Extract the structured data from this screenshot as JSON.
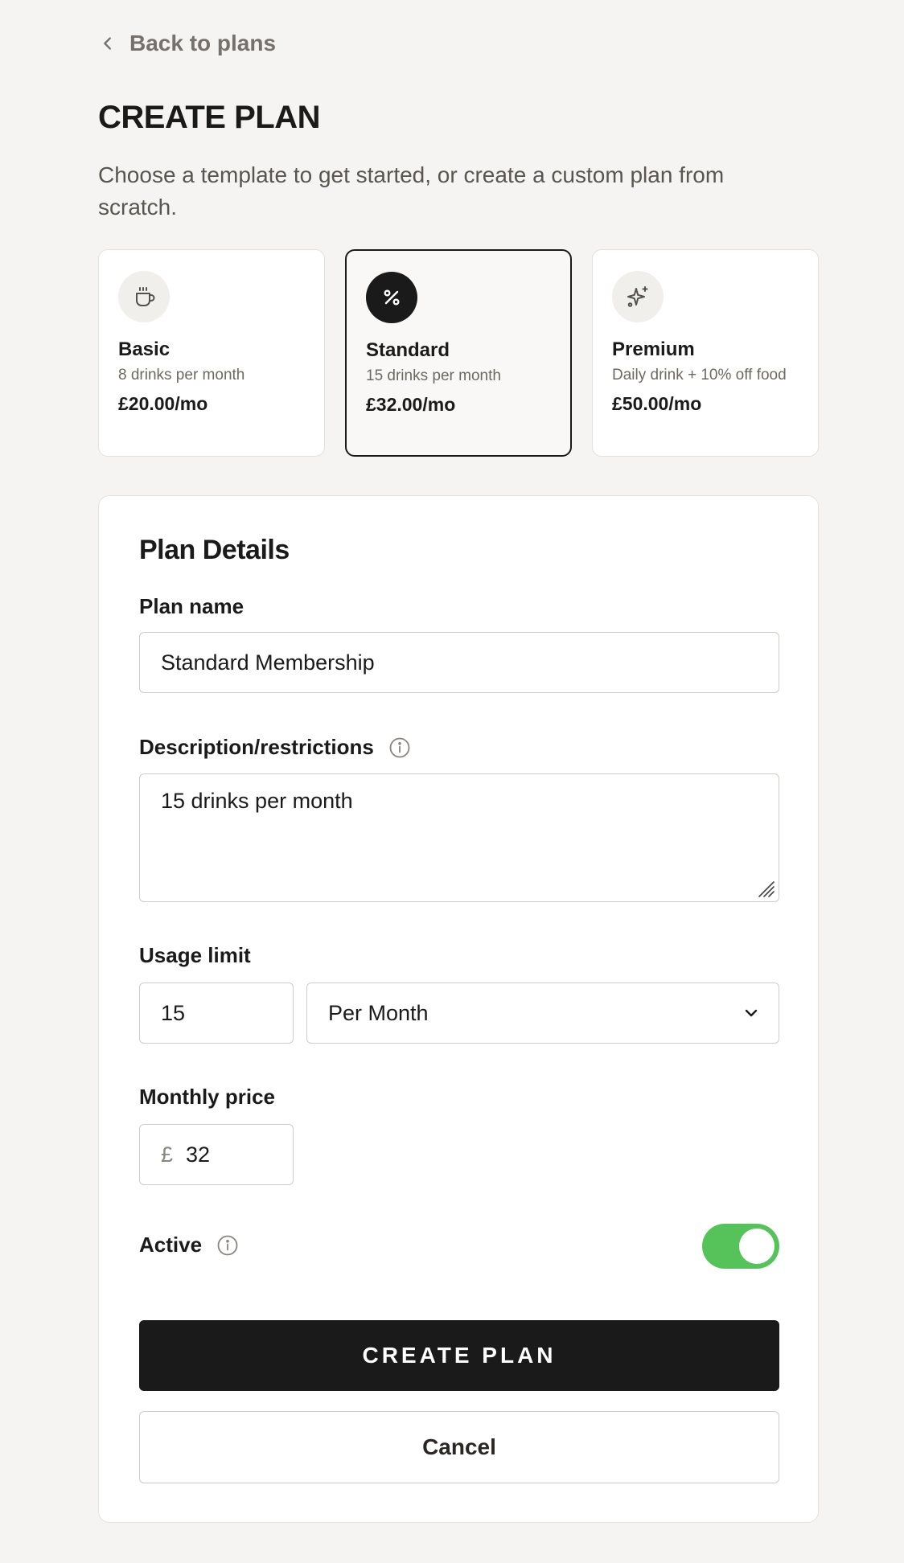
{
  "nav": {
    "back_label": "Back to plans",
    "back_icon": "chevron-left-icon"
  },
  "header": {
    "title": "CREATE PLAN",
    "subtitle": "Choose a template to get started, or create a custom plan from scratch."
  },
  "templates": [
    {
      "name": "Basic",
      "description": "8 drinks per month",
      "price": "£20.00/mo",
      "icon": "coffee-cup-icon",
      "selected": false
    },
    {
      "name": "Standard",
      "description": "15 drinks per month",
      "price": "£32.00/mo",
      "icon": "percent-icon",
      "selected": true
    },
    {
      "name": "Premium",
      "description": "Daily drink + 10% off food",
      "price": "£50.00/mo",
      "icon": "sparkle-icon",
      "selected": false
    }
  ],
  "form": {
    "title": "Plan Details",
    "plan_name": {
      "label": "Plan name",
      "value": "Standard Membership"
    },
    "description": {
      "label": "Description/restrictions",
      "value": "15 drinks per month"
    },
    "usage_limit": {
      "label": "Usage limit",
      "value": "15",
      "period": "Per Month"
    },
    "monthly_price": {
      "label": "Monthly price",
      "currency": "£",
      "value": "32"
    },
    "active": {
      "label": "Active",
      "on": true
    }
  },
  "actions": {
    "create_label": "CREATE PLAN",
    "cancel_label": "Cancel"
  },
  "colors": {
    "background": "#f5f4f2",
    "primary": "#1a1a1a",
    "toggle_on": "#55c35a",
    "border": "#cfcbc6",
    "muted_text": "#77716b"
  }
}
